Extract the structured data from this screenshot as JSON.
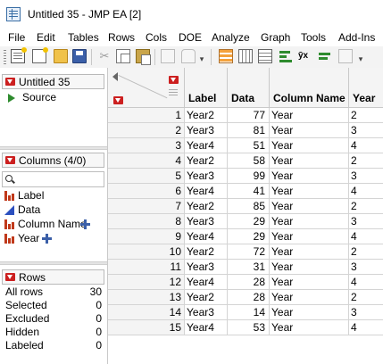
{
  "window": {
    "title": "Untitled 35 - JMP EA [2]"
  },
  "menu": [
    "File",
    "Edit",
    "Tables",
    "Rows",
    "Cols",
    "DOE",
    "Analyze",
    "Graph",
    "Tools",
    "Add-Ins"
  ],
  "table_panel": {
    "title": "Untitled 35",
    "source_label": "Source"
  },
  "columns_panel": {
    "title": "Columns (4/0)",
    "items": [
      {
        "label": "Label",
        "icon": "nominal-icon",
        "has_cross": false
      },
      {
        "label": "Data",
        "icon": "continuous-icon",
        "has_cross": false
      },
      {
        "label": "Column Name",
        "icon": "nominal-icon",
        "has_cross": true
      },
      {
        "label": "Year",
        "icon": "nominal-icon",
        "has_cross": true
      }
    ]
  },
  "rows_panel": {
    "title": "Rows",
    "stats": [
      {
        "label": "All rows",
        "value": "30"
      },
      {
        "label": "Selected",
        "value": "0"
      },
      {
        "label": "Excluded",
        "value": "0"
      },
      {
        "label": "Hidden",
        "value": "0"
      },
      {
        "label": "Labeled",
        "value": "0"
      }
    ]
  },
  "grid": {
    "headers": [
      "Label",
      "Data",
      "Column Name",
      "Year"
    ],
    "rows": [
      {
        "n": "1",
        "label": "Year2",
        "data": "77",
        "colname": "Year",
        "year": "2"
      },
      {
        "n": "2",
        "label": "Year3",
        "data": "81",
        "colname": "Year",
        "year": "3"
      },
      {
        "n": "3",
        "label": "Year4",
        "data": "51",
        "colname": "Year",
        "year": "4"
      },
      {
        "n": "4",
        "label": "Year2",
        "data": "58",
        "colname": "Year",
        "year": "2"
      },
      {
        "n": "5",
        "label": "Year3",
        "data": "99",
        "colname": "Year",
        "year": "3"
      },
      {
        "n": "6",
        "label": "Year4",
        "data": "41",
        "colname": "Year",
        "year": "4"
      },
      {
        "n": "7",
        "label": "Year2",
        "data": "85",
        "colname": "Year",
        "year": "2"
      },
      {
        "n": "8",
        "label": "Year3",
        "data": "29",
        "colname": "Year",
        "year": "3"
      },
      {
        "n": "9",
        "label": "Year4",
        "data": "29",
        "colname": "Year",
        "year": "4"
      },
      {
        "n": "10",
        "label": "Year2",
        "data": "72",
        "colname": "Year",
        "year": "2"
      },
      {
        "n": "11",
        "label": "Year3",
        "data": "31",
        "colname": "Year",
        "year": "3"
      },
      {
        "n": "12",
        "label": "Year4",
        "data": "28",
        "colname": "Year",
        "year": "4"
      },
      {
        "n": "13",
        "label": "Year2",
        "data": "28",
        "colname": "Year",
        "year": "2"
      },
      {
        "n": "14",
        "label": "Year3",
        "data": "14",
        "colname": "Year",
        "year": "3"
      },
      {
        "n": "15",
        "label": "Year4",
        "data": "53",
        "colname": "Year",
        "year": "4"
      }
    ]
  }
}
